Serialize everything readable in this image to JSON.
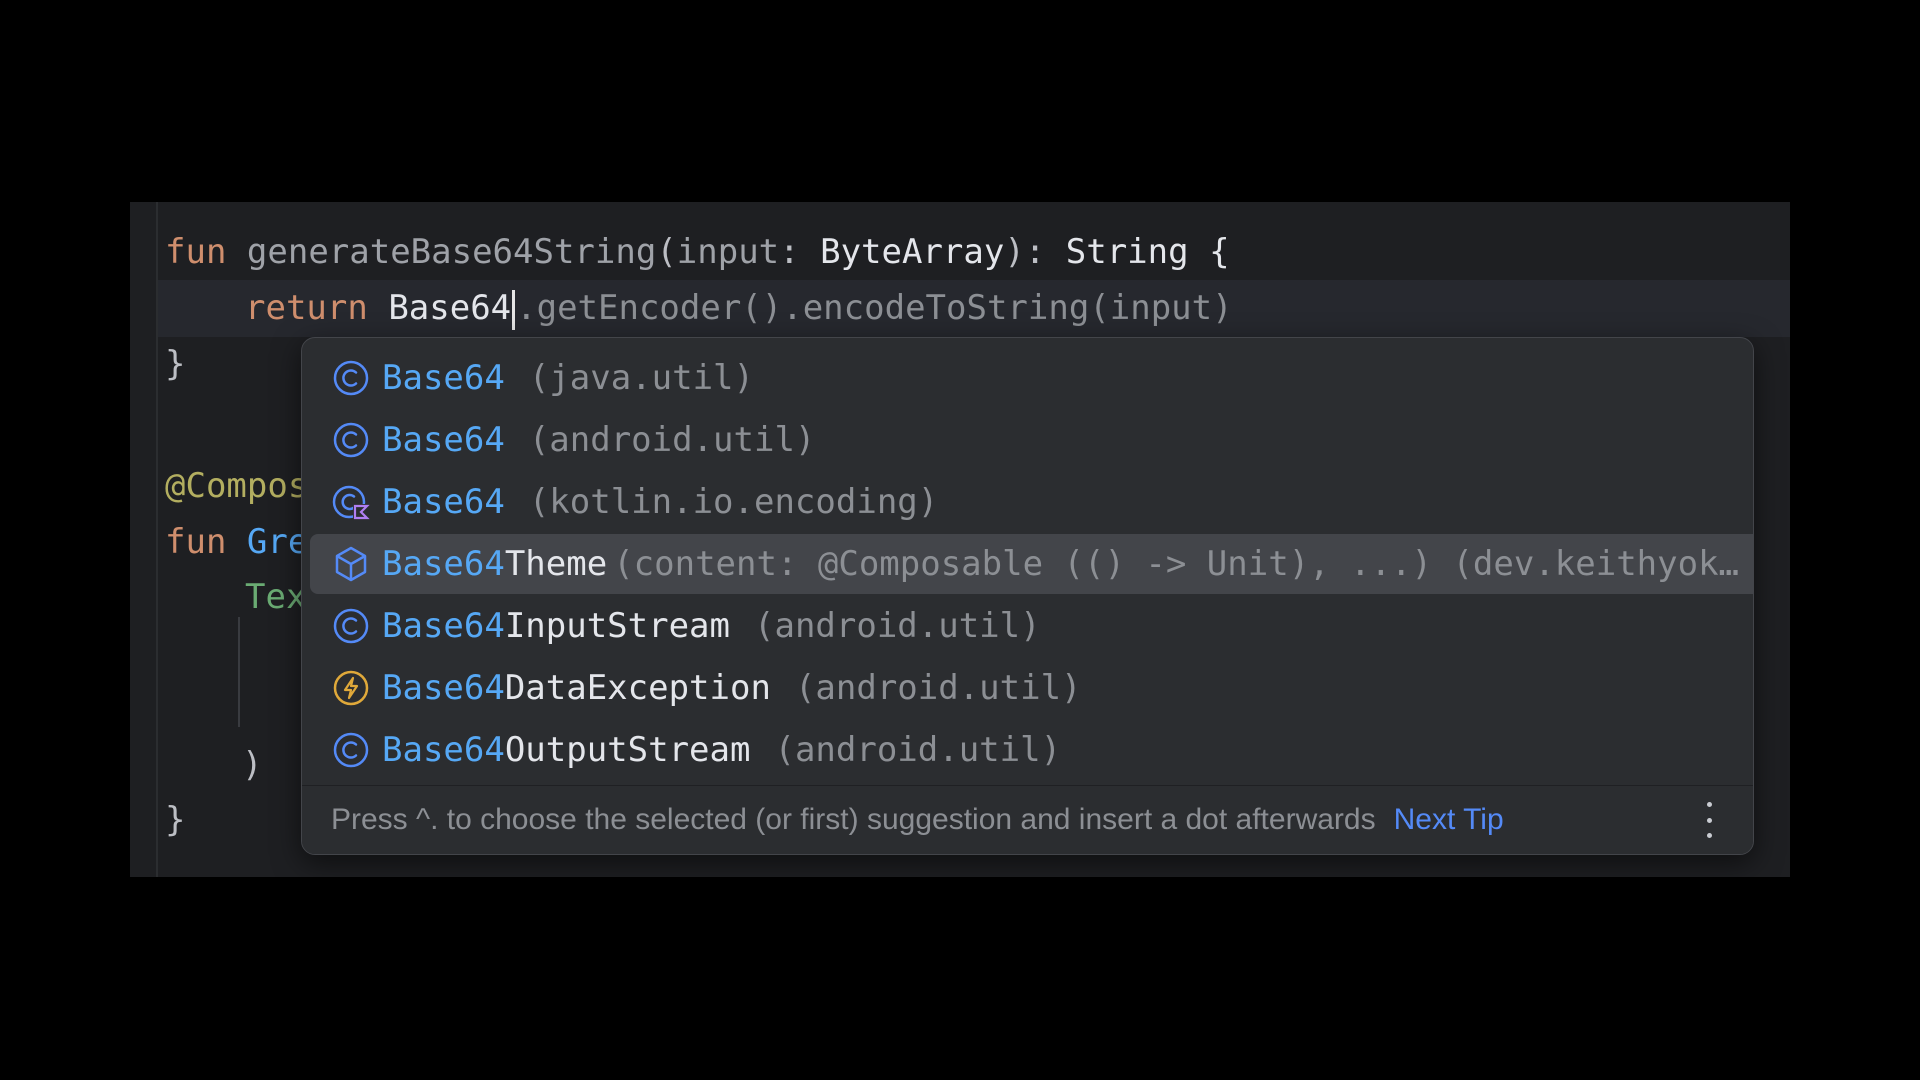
{
  "editor": {
    "line1": {
      "kw": "fun",
      "name": "generateBase64String",
      "open": "(",
      "param": "input",
      "colon": ": ",
      "type": "ByteArray",
      "close": "): ",
      "ret": "String",
      "brace": " {"
    },
    "line2": {
      "kw": "return",
      "typed": "Base64",
      "rest": ".getEncoder().encodeToString(input)"
    },
    "line3": "}",
    "line4": "@Compos",
    "line5": {
      "kw": "fun",
      "name": "Gre"
    },
    "line6": "Tex",
    "line7": ")",
    "line8": "}"
  },
  "completion": {
    "items": [
      {
        "icon": "class-icon",
        "match": "Base64",
        "rest": "",
        "tail": "(java.util)"
      },
      {
        "icon": "class-icon",
        "match": "Base64",
        "rest": "",
        "tail": "(android.util)"
      },
      {
        "icon": "kotlin-class-icon",
        "match": "Base64",
        "rest": "",
        "tail": "(kotlin.io.encoding)"
      },
      {
        "icon": "composable-function-icon",
        "match": "Base64",
        "rest": "Theme",
        "tail": "(content: @Composable (() -> Unit), ...) (dev.keithyok…"
      },
      {
        "icon": "class-icon",
        "match": "Base64",
        "rest": "InputStream",
        "tail": "(android.util)"
      },
      {
        "icon": "exception-icon",
        "match": "Base64",
        "rest": "DataException",
        "tail": "(android.util)"
      },
      {
        "icon": "class-icon",
        "match": "Base64",
        "rest": "OutputStream",
        "tail": "(android.util)"
      }
    ],
    "selected_index": 3,
    "footer": {
      "tip": "Press ^. to choose the selected (or first) suggestion and insert a dot afterwards",
      "next_tip": "Next Tip"
    }
  },
  "colors": {
    "match": "#56a8f5",
    "keyword": "#cf8e6d",
    "annotation": "#b3ae60",
    "link": "#548af7"
  }
}
